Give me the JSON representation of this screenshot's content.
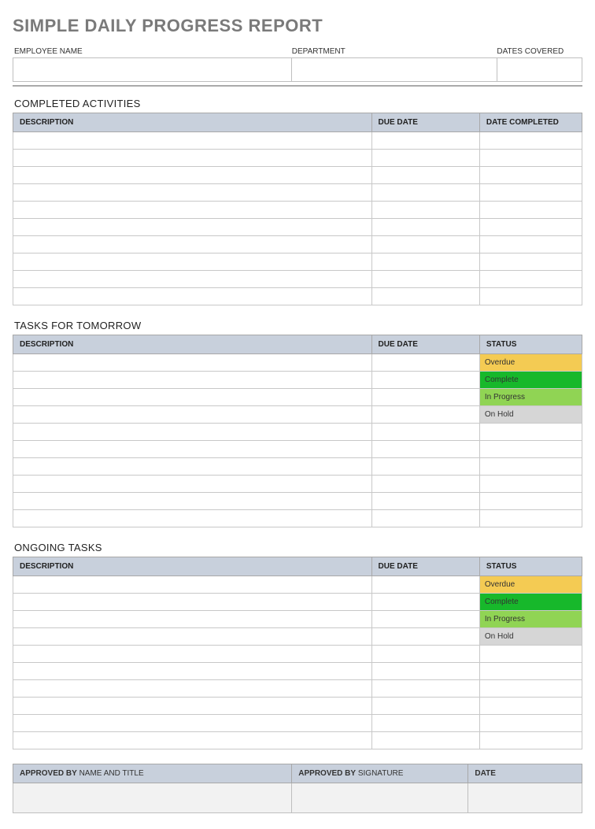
{
  "title": "SIMPLE DAILY PROGRESS REPORT",
  "info": {
    "employee_label": "EMPLOYEE NAME",
    "department_label": "DEPARTMENT",
    "dates_label": "DATES COVERED",
    "employee_value": "",
    "department_value": "",
    "dates_value": ""
  },
  "completed": {
    "title": "COMPLETED ACTIVITIES",
    "headers": {
      "desc": "DESCRIPTION",
      "due": "DUE DATE",
      "done": "DATE COMPLETED"
    },
    "rows": [
      {
        "desc": "",
        "due": "",
        "done": ""
      },
      {
        "desc": "",
        "due": "",
        "done": ""
      },
      {
        "desc": "",
        "due": "",
        "done": ""
      },
      {
        "desc": "",
        "due": "",
        "done": ""
      },
      {
        "desc": "",
        "due": "",
        "done": ""
      },
      {
        "desc": "",
        "due": "",
        "done": ""
      },
      {
        "desc": "",
        "due": "",
        "done": ""
      },
      {
        "desc": "",
        "due": "",
        "done": ""
      },
      {
        "desc": "",
        "due": "",
        "done": ""
      },
      {
        "desc": "",
        "due": "",
        "done": ""
      }
    ]
  },
  "tomorrow": {
    "title": "TASKS FOR TOMORROW",
    "headers": {
      "desc": "DESCRIPTION",
      "due": "DUE DATE",
      "status": "STATUS"
    },
    "rows": [
      {
        "desc": "",
        "due": "",
        "status": "Overdue",
        "status_class": "status-overdue"
      },
      {
        "desc": "",
        "due": "",
        "status": "Complete",
        "status_class": "status-complete"
      },
      {
        "desc": "",
        "due": "",
        "status": "In Progress",
        "status_class": "status-inprogress"
      },
      {
        "desc": "",
        "due": "",
        "status": "On Hold",
        "status_class": "status-onhold"
      },
      {
        "desc": "",
        "due": "",
        "status": "",
        "status_class": ""
      },
      {
        "desc": "",
        "due": "",
        "status": "",
        "status_class": ""
      },
      {
        "desc": "",
        "due": "",
        "status": "",
        "status_class": ""
      },
      {
        "desc": "",
        "due": "",
        "status": "",
        "status_class": ""
      },
      {
        "desc": "",
        "due": "",
        "status": "",
        "status_class": ""
      },
      {
        "desc": "",
        "due": "",
        "status": "",
        "status_class": ""
      }
    ]
  },
  "ongoing": {
    "title": "ONGOING TASKS",
    "headers": {
      "desc": "DESCRIPTION",
      "due": "DUE DATE",
      "status": "STATUS"
    },
    "rows": [
      {
        "desc": "",
        "due": "",
        "status": "Overdue",
        "status_class": "status-overdue"
      },
      {
        "desc": "",
        "due": "",
        "status": "Complete",
        "status_class": "status-complete"
      },
      {
        "desc": "",
        "due": "",
        "status": "In Progress",
        "status_class": "status-inprogress"
      },
      {
        "desc": "",
        "due": "",
        "status": "On Hold",
        "status_class": "status-onhold"
      },
      {
        "desc": "",
        "due": "",
        "status": "",
        "status_class": ""
      },
      {
        "desc": "",
        "due": "",
        "status": "",
        "status_class": ""
      },
      {
        "desc": "",
        "due": "",
        "status": "",
        "status_class": ""
      },
      {
        "desc": "",
        "due": "",
        "status": "",
        "status_class": ""
      },
      {
        "desc": "",
        "due": "",
        "status": "",
        "status_class": ""
      },
      {
        "desc": "",
        "due": "",
        "status": "",
        "status_class": ""
      }
    ]
  },
  "approval": {
    "by_bold": "APPROVED BY",
    "name_title": "NAME AND TITLE",
    "signature": "SIGNATURE",
    "date": "DATE",
    "name_value": "",
    "signature_value": "",
    "date_value": ""
  }
}
